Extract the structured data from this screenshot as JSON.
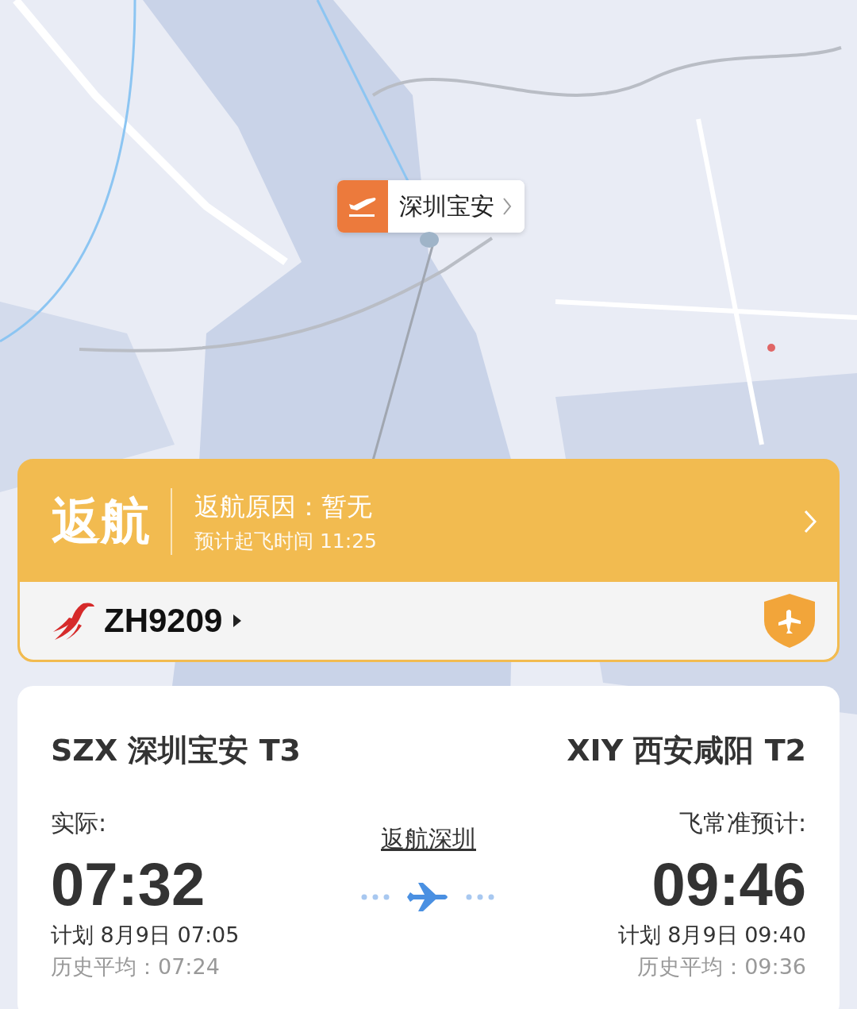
{
  "map": {
    "airport_marker": {
      "label": "深圳宝安"
    }
  },
  "status": {
    "title": "返航",
    "reason": "返航原因：暂无",
    "departure_estimate": "预计起飞时间 11:25"
  },
  "flight": {
    "number": "ZH9209"
  },
  "route": {
    "status_link": "返航深圳",
    "origin": {
      "airport": "SZX 深圳宝安 T3",
      "time_label": "实际:",
      "time": "07:32",
      "scheduled": "计划 8月9日 07:05",
      "history": "历史平均：07:24"
    },
    "destination": {
      "airport": "XIY 西安咸阳 T2",
      "time_label": "飞常准预计:",
      "time": "09:46",
      "scheduled": "计划 8月9日 09:40",
      "history": "历史平均：09:36"
    }
  }
}
